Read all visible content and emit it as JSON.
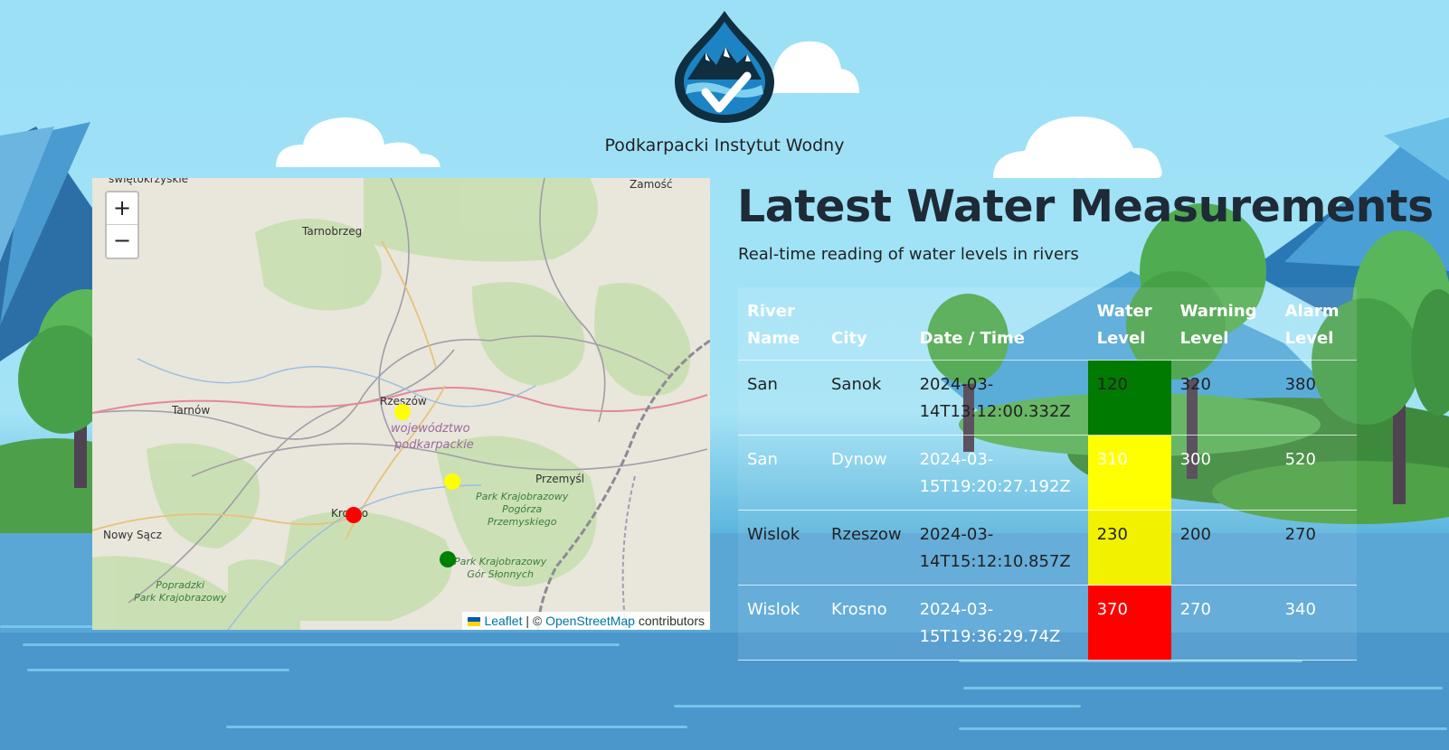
{
  "header": {
    "logo_icon": "water-drop-mountains-check-icon",
    "org_name": "Podkarpacki Instytut Wodny"
  },
  "map": {
    "zoom_in_label": "+",
    "zoom_out_label": "−",
    "attribution": {
      "flag_colors": [
        "#0057b7",
        "#ffd700"
      ],
      "leaflet": "Leaflet",
      "separator": "| ©",
      "osm": "OpenStreetMap",
      "suffix": "contributors"
    },
    "labels": {
      "swietokrzyskie": "świętokrzyskie",
      "zamosc": "Zamość",
      "tarnobrzeg": "Tarnobrzeg",
      "tarnow": "Tarnów",
      "rzeszow": "Rzeszów",
      "wojewodztwo": "województwo",
      "podkarpackie": "podkarpackie",
      "przemysl": "Przemyśl",
      "park1_line1": "Park Krajobrazowy",
      "park1_line2": "Pogórza",
      "park1_line3": "Przemyskiego",
      "krosno": "Krosno",
      "nowy_sacz": "Nowy Sącz",
      "park2_line1": "Park Krajobrazowy",
      "park2_line2": "Gór Słonnych",
      "popradzki_line1": "Popradzki",
      "popradzki_line2": "Park Krajobrazowy"
    },
    "markers": [
      {
        "city": "Rzeszow",
        "color": "#ffff00"
      },
      {
        "city": "Dynow",
        "color": "#ffff00"
      },
      {
        "city": "Krosno",
        "color": "#ff0000"
      },
      {
        "city": "Sanok",
        "color": "#008000"
      }
    ]
  },
  "main": {
    "title": "Latest Water Measurements",
    "subtitle": "Real-time reading of water levels in rivers"
  },
  "table": {
    "headers": {
      "river": [
        "River",
        "Name"
      ],
      "city": "City",
      "datetime": "Date / Time",
      "water": [
        "Water",
        "Level"
      ],
      "warning": [
        "Warning",
        "Level"
      ],
      "alarm": [
        "Alarm",
        "Level"
      ]
    },
    "rows": [
      {
        "river": "San",
        "city": "Sanok",
        "date1": "2024-03-",
        "date2": "14T13:12:00.332Z",
        "water": "120",
        "water_color": "#007a00",
        "warning": "320",
        "alarm": "380"
      },
      {
        "river": "San",
        "city": "Dynow",
        "date1": "2024-03-",
        "date2": "15T19:20:27.192Z",
        "water": "310",
        "water_color": "#ffff00",
        "warning": "300",
        "alarm": "520"
      },
      {
        "river": "Wislok",
        "city": "Rzeszow",
        "date1": "2024-03-",
        "date2": "14T15:12:10.857Z",
        "water": "230",
        "water_color": "#f2f200",
        "warning": "200",
        "alarm": "270"
      },
      {
        "river": "Wislok",
        "city": "Krosno",
        "date1": "2024-03-",
        "date2": "15T19:36:29.74Z",
        "water": "370",
        "water_color": "#ff0000",
        "warning": "270",
        "alarm": "340"
      }
    ]
  }
}
